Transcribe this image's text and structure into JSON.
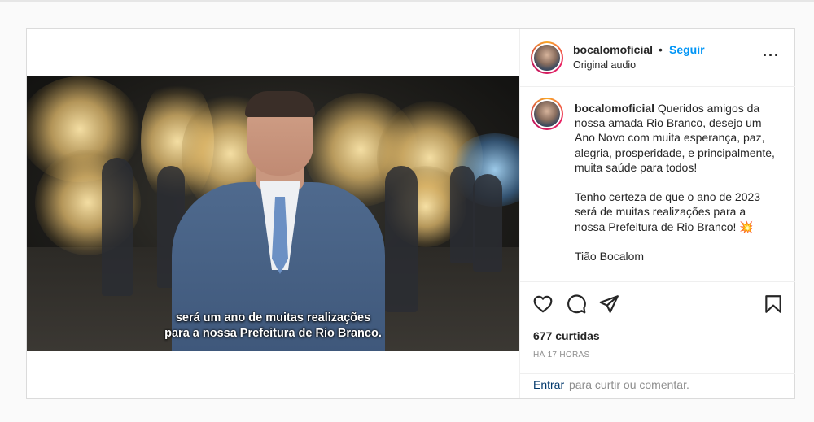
{
  "post": {
    "username": "bocalomoficial",
    "separator": "•",
    "follow_label": "Seguir",
    "audio_label": "Original audio",
    "more_label": "···"
  },
  "video": {
    "subtitle_line1": "será um ano de muitas realizações",
    "subtitle_line2": "para a nossa Prefeitura de Rio Branco."
  },
  "caption": {
    "username": "bocalomoficial",
    "text": " Queridos amigos da nossa amada Rio Branco, desejo um Ano Novo com muita esperança, paz, alegria, prosperidade, e principalmente, muita saúde para todos!\n\nTenho certeza de que o ano de 2023 será de muitas realizações para a nossa Prefeitura de Rio Branco! 💥\n\nTião Bocalom"
  },
  "actions": {
    "like_icon": "heart-icon",
    "comment_icon": "comment-icon",
    "share_icon": "send-icon",
    "save_icon": "bookmark-icon"
  },
  "stats": {
    "likes": "677 curtidas",
    "time": "HÁ 17 HORAS"
  },
  "comment": {
    "login_link": "Entrar",
    "login_rest": "para curtir ou comentar."
  },
  "colors": {
    "accent": "#0095f6",
    "link": "#00376b",
    "muted": "#8e8e8e",
    "border": "#dbdbdb"
  }
}
